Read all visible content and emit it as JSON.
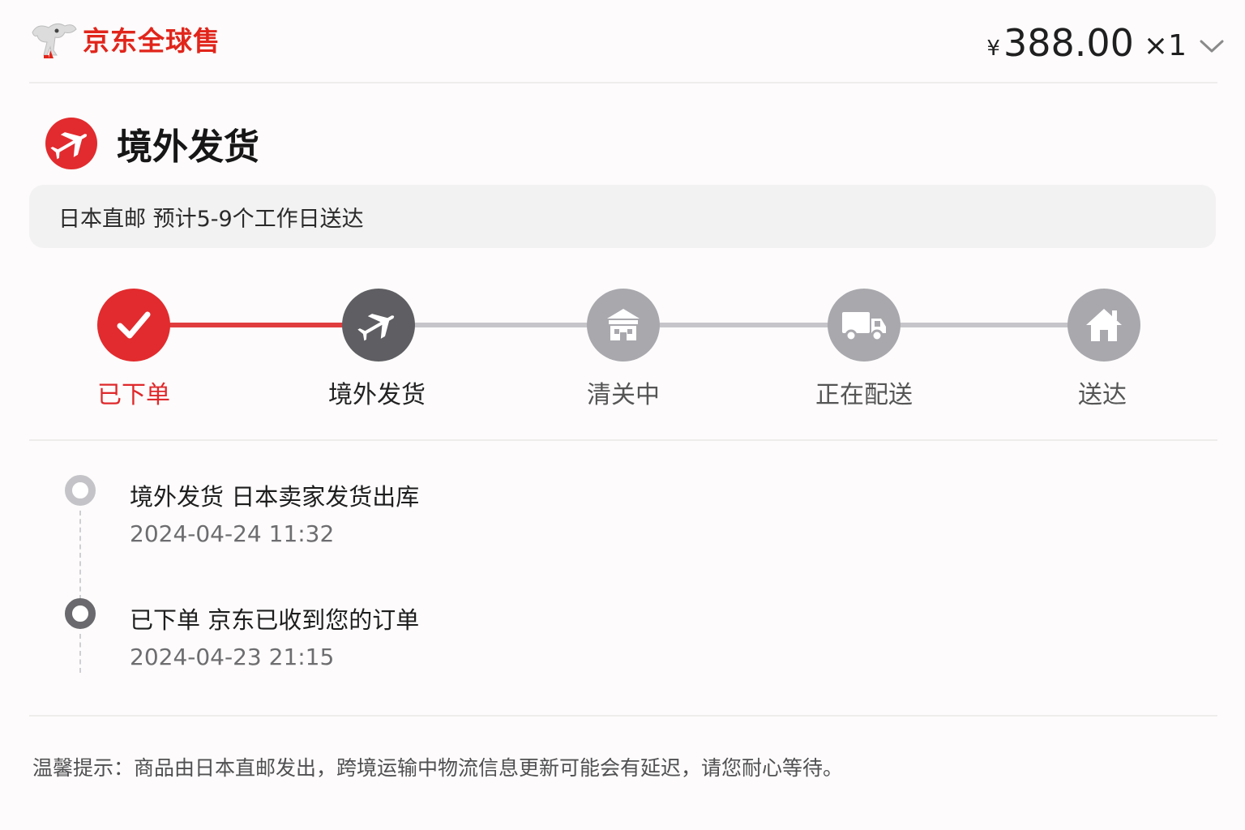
{
  "header": {
    "brand_name": "京东全球售",
    "currency": "¥",
    "price": "388.00",
    "quantity": "×1"
  },
  "shipping": {
    "title": "境外发货",
    "info": "日本直邮  预计5-9个工作日送达"
  },
  "steps": [
    {
      "label": "已下单",
      "status": "done",
      "icon": "check-icon"
    },
    {
      "label": "境外发货",
      "status": "current",
      "icon": "airplane-icon"
    },
    {
      "label": "清关中",
      "status": "pending",
      "icon": "customs-building-icon"
    },
    {
      "label": "正在配送",
      "status": "pending",
      "icon": "truck-icon"
    },
    {
      "label": "送达",
      "status": "pending",
      "icon": "house-icon"
    }
  ],
  "timeline": [
    {
      "title": "境外发货  日本卖家发货出库",
      "time": "2024-04-24 11:32"
    },
    {
      "title": "已下单  京东已收到您的订单",
      "time": "2024-04-23 21:15"
    }
  ],
  "tip": "温馨提示：商品由日本直邮发出，跨境运输中物流信息更新可能会有延迟，请您耐心等待。",
  "colors": {
    "accent": "#e1251b",
    "current": "#5f5f63",
    "pending": "#a8a8ad"
  }
}
